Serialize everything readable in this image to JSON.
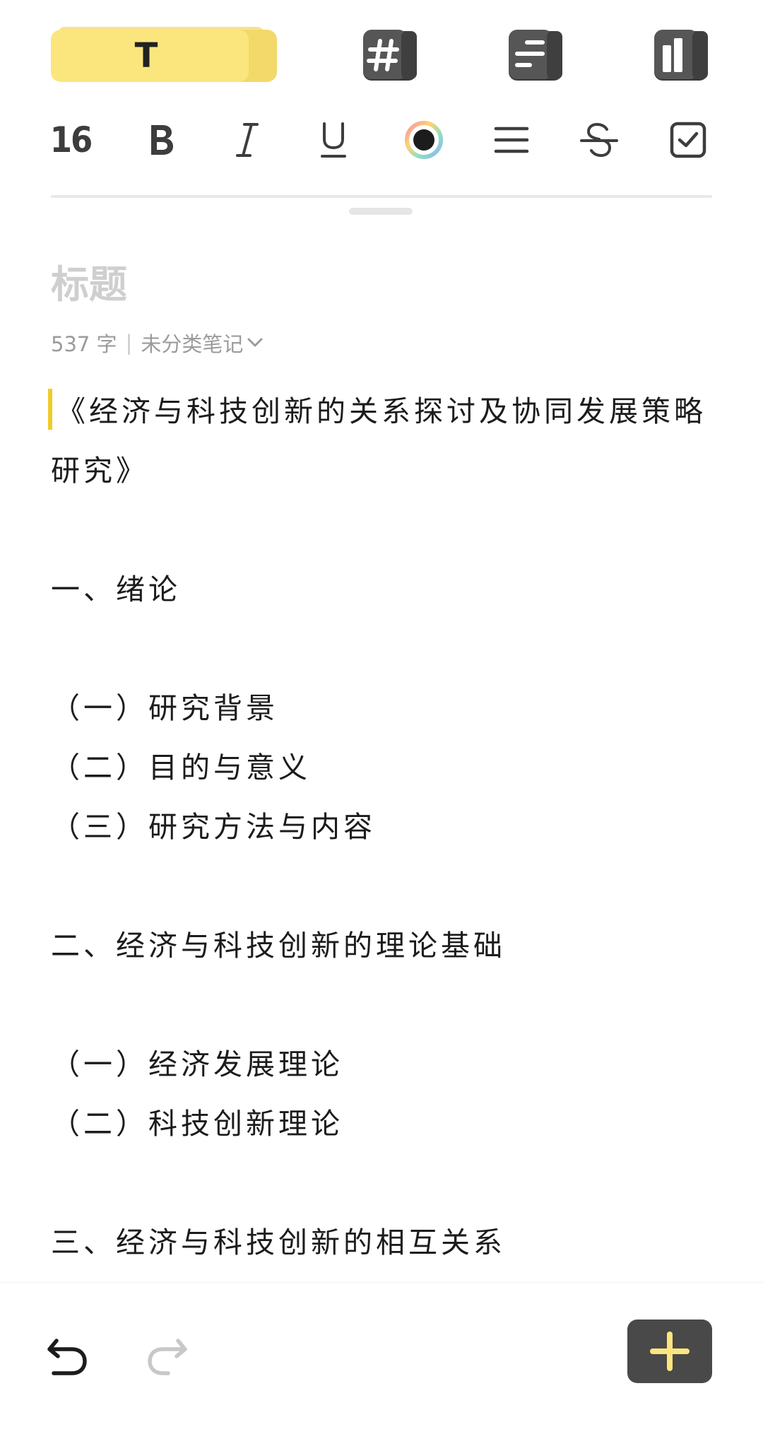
{
  "toolbar": {
    "tabs": [
      {
        "name": "text",
        "glyph": "T",
        "active": true
      },
      {
        "name": "tag"
      },
      {
        "name": "outline"
      },
      {
        "name": "layout"
      }
    ],
    "accent_color": "#fbe67e",
    "dark_color": "#494949"
  },
  "format_bar": {
    "font_size": "16",
    "icons": [
      "bold-icon",
      "italic-icon",
      "underline-icon",
      "color-icon",
      "align-icon",
      "strikethrough-icon",
      "checkbox-icon"
    ]
  },
  "note": {
    "title_placeholder": "标题",
    "word_count": "537 字",
    "category": "未分类笔记",
    "lines": [
      "《经济与科技创新的关系探讨及协同发展策略研究》",
      "",
      "一、绪论",
      "",
      "（一）研究背景",
      "（二）目的与意义",
      "（三）研究方法与内容",
      "",
      "二、经济与科技创新的理论基础",
      "",
      "（一）经济发展理论",
      "（二）科技创新理论",
      "",
      "三、经济与科技创新的相互关系"
    ]
  },
  "bottom_bar": {
    "actions": [
      "undo-icon",
      "redo-icon",
      "add-icon"
    ]
  }
}
